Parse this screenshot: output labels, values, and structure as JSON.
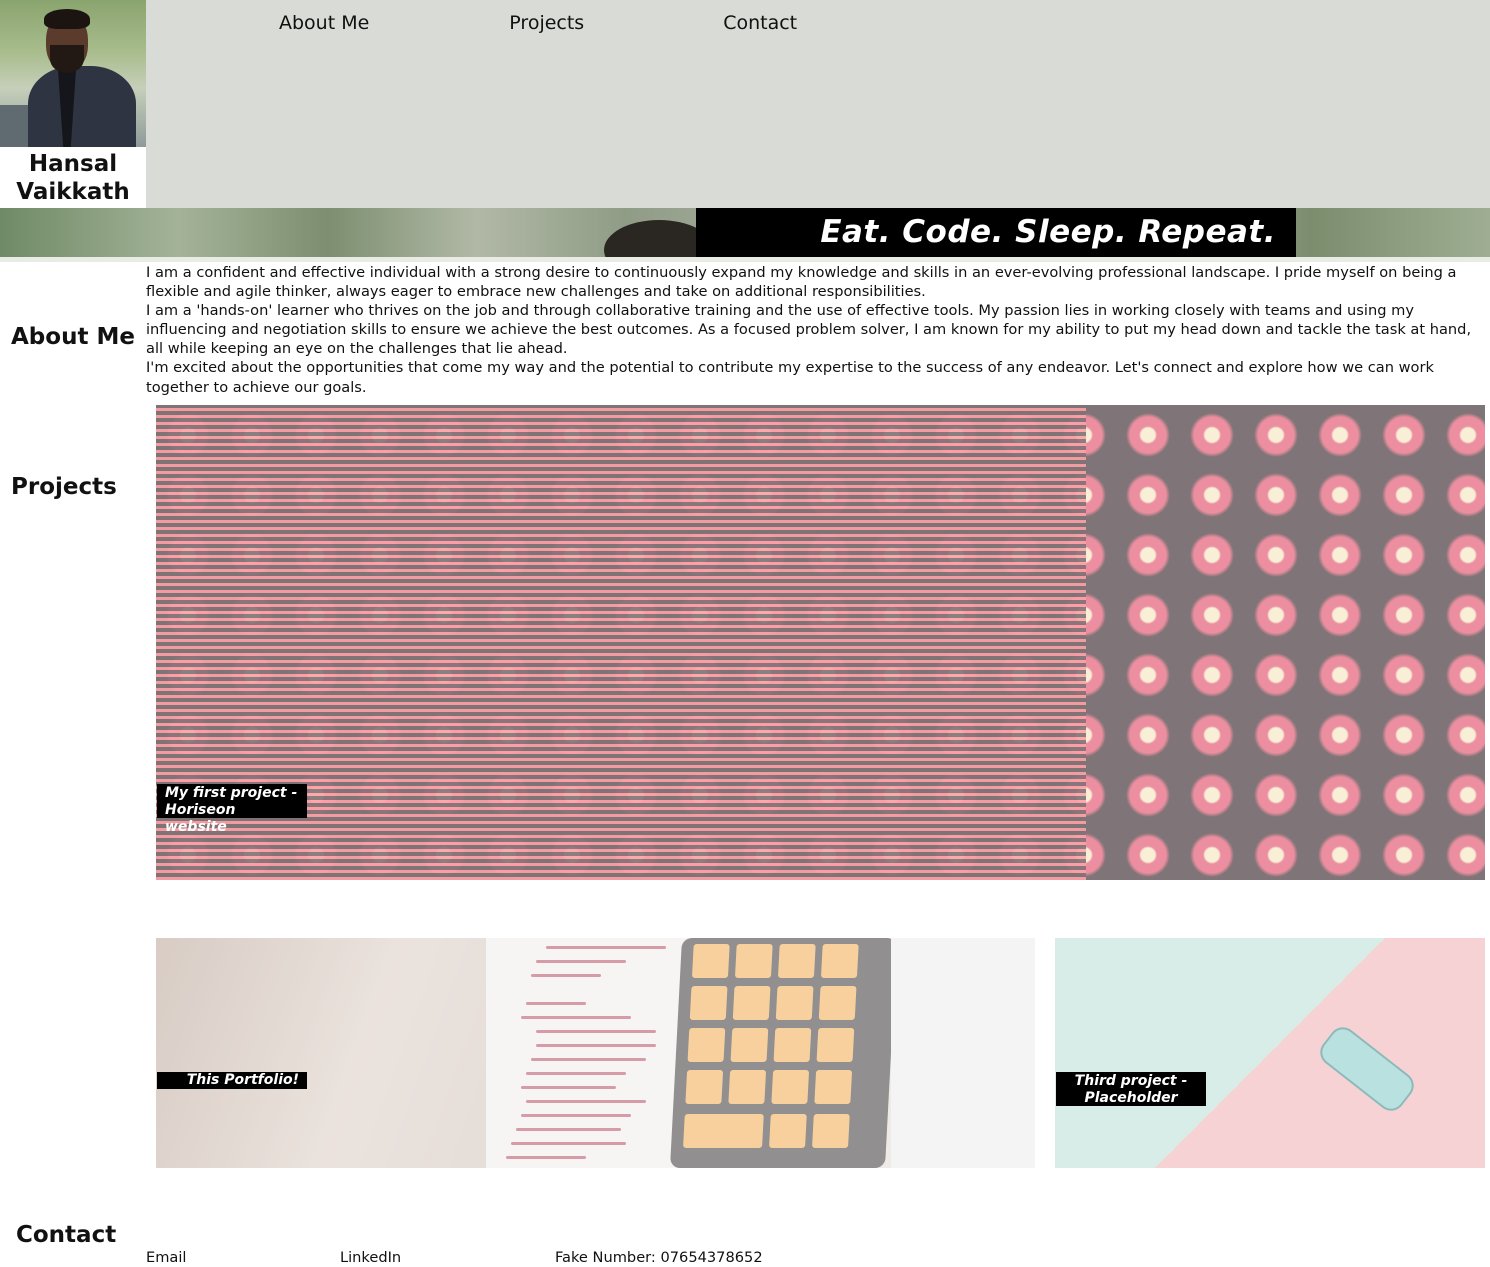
{
  "header": {
    "name": "Hansal Vaikkath",
    "avatar_alt": "Hansal Vaikkath",
    "nav": [
      {
        "label": "About Me"
      },
      {
        "label": "Projects"
      },
      {
        "label": "Contact"
      }
    ]
  },
  "banner": {
    "tagline": "Eat. Code. Sleep. Repeat."
  },
  "about": {
    "heading": "About Me",
    "paragraphs": [
      "I am a confident and effective individual with a strong desire to continuously expand my knowledge and skills in an ever-evolving professional landscape. I pride myself on being a flexible and agile thinker, always eager to embrace new challenges and take on additional responsibilities.",
      "I am a 'hands-on' learner who thrives on the job and through collaborative training and the use of effective tools. My passion lies in working closely with teams and using my influencing and negotiation skills to ensure we achieve the best outcomes. As a focused problem solver, I am known for my ability to put my head down and tackle the task at hand, all while keeping an eye on the challenges that lie ahead.",
      "I'm excited about the opportunities that come my way and the potential to contribute my expertise to the success of any endeavor. Let's connect and explore how we can work together to achieve our goals."
    ]
  },
  "projects": {
    "heading": "Projects",
    "items": [
      {
        "caption": "My first project - Horiseon website"
      },
      {
        "caption": "This Portfolio!"
      },
      {
        "caption": "Third project - Placeholder"
      }
    ]
  },
  "contact": {
    "heading": "Contact",
    "email_label": "Email",
    "linkedin_label": "LinkedIn",
    "phone_label": "Fake Number: 07654378652"
  },
  "colors": {
    "header_bg": "#d9dbd6",
    "caption_bg": "#000000",
    "caption_text": "#ffffff"
  }
}
